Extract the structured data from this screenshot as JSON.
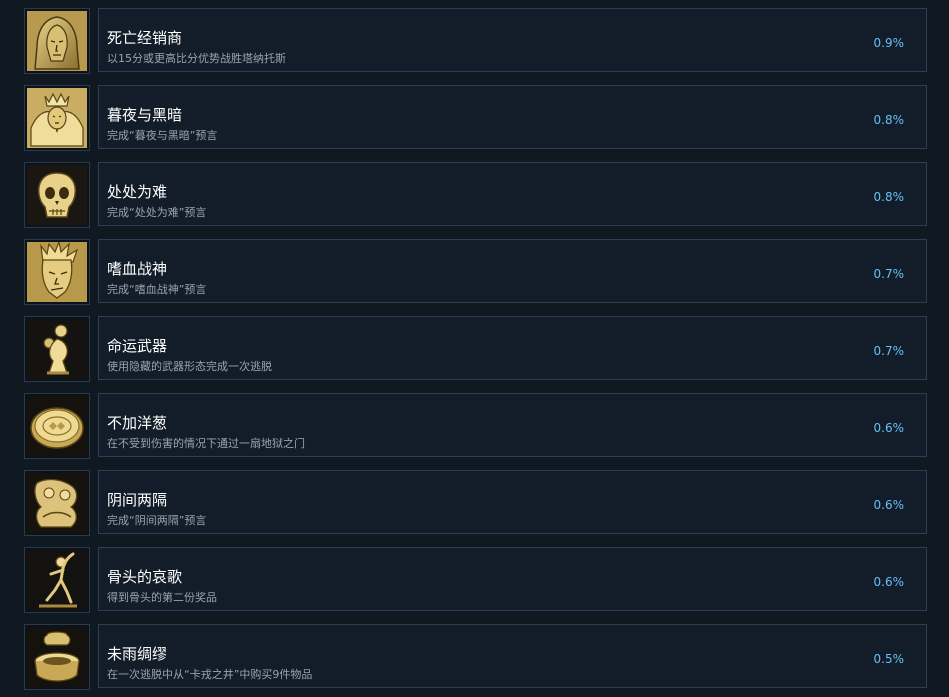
{
  "achievements": [
    {
      "title": "死亡经销商",
      "description": "以15分或更高比分优势战胜塔纳托斯",
      "percent": "0.9%",
      "icon": "hooded-figure-icon"
    },
    {
      "title": "暮夜与黑暗",
      "description": "完成“暮夜与黑暗”预言",
      "percent": "0.8%",
      "icon": "winged-goddess-icon"
    },
    {
      "title": "处处为难",
      "description": "完成“处处为难”预言",
      "percent": "0.8%",
      "icon": "skull-icon"
    },
    {
      "title": "嗜血战神",
      "description": "完成“嗜血战神”预言",
      "percent": "0.7%",
      "icon": "warrior-face-icon"
    },
    {
      "title": "命运武器",
      "description": "使用隐藏的武器形态完成一次逃脱",
      "percent": "0.7%",
      "icon": "golden-weapon-icon"
    },
    {
      "title": "不加洋葱",
      "description": "在不受到伤害的情况下通过一扇地狱之门",
      "percent": "0.6%",
      "icon": "coin-icon"
    },
    {
      "title": "阴间两隔",
      "description": "完成“阴间两隔”预言",
      "percent": "0.6%",
      "icon": "figures-relief-icon"
    },
    {
      "title": "骨头的哀歌",
      "description": "得到骨头的第二份奖品",
      "percent": "0.6%",
      "icon": "skeleton-dancer-icon"
    },
    {
      "title": "未雨绸缪",
      "description": "在一次逃脱中从“卡戎之井”中购买9件物品",
      "percent": "0.5%",
      "icon": "well-icon"
    }
  ]
}
